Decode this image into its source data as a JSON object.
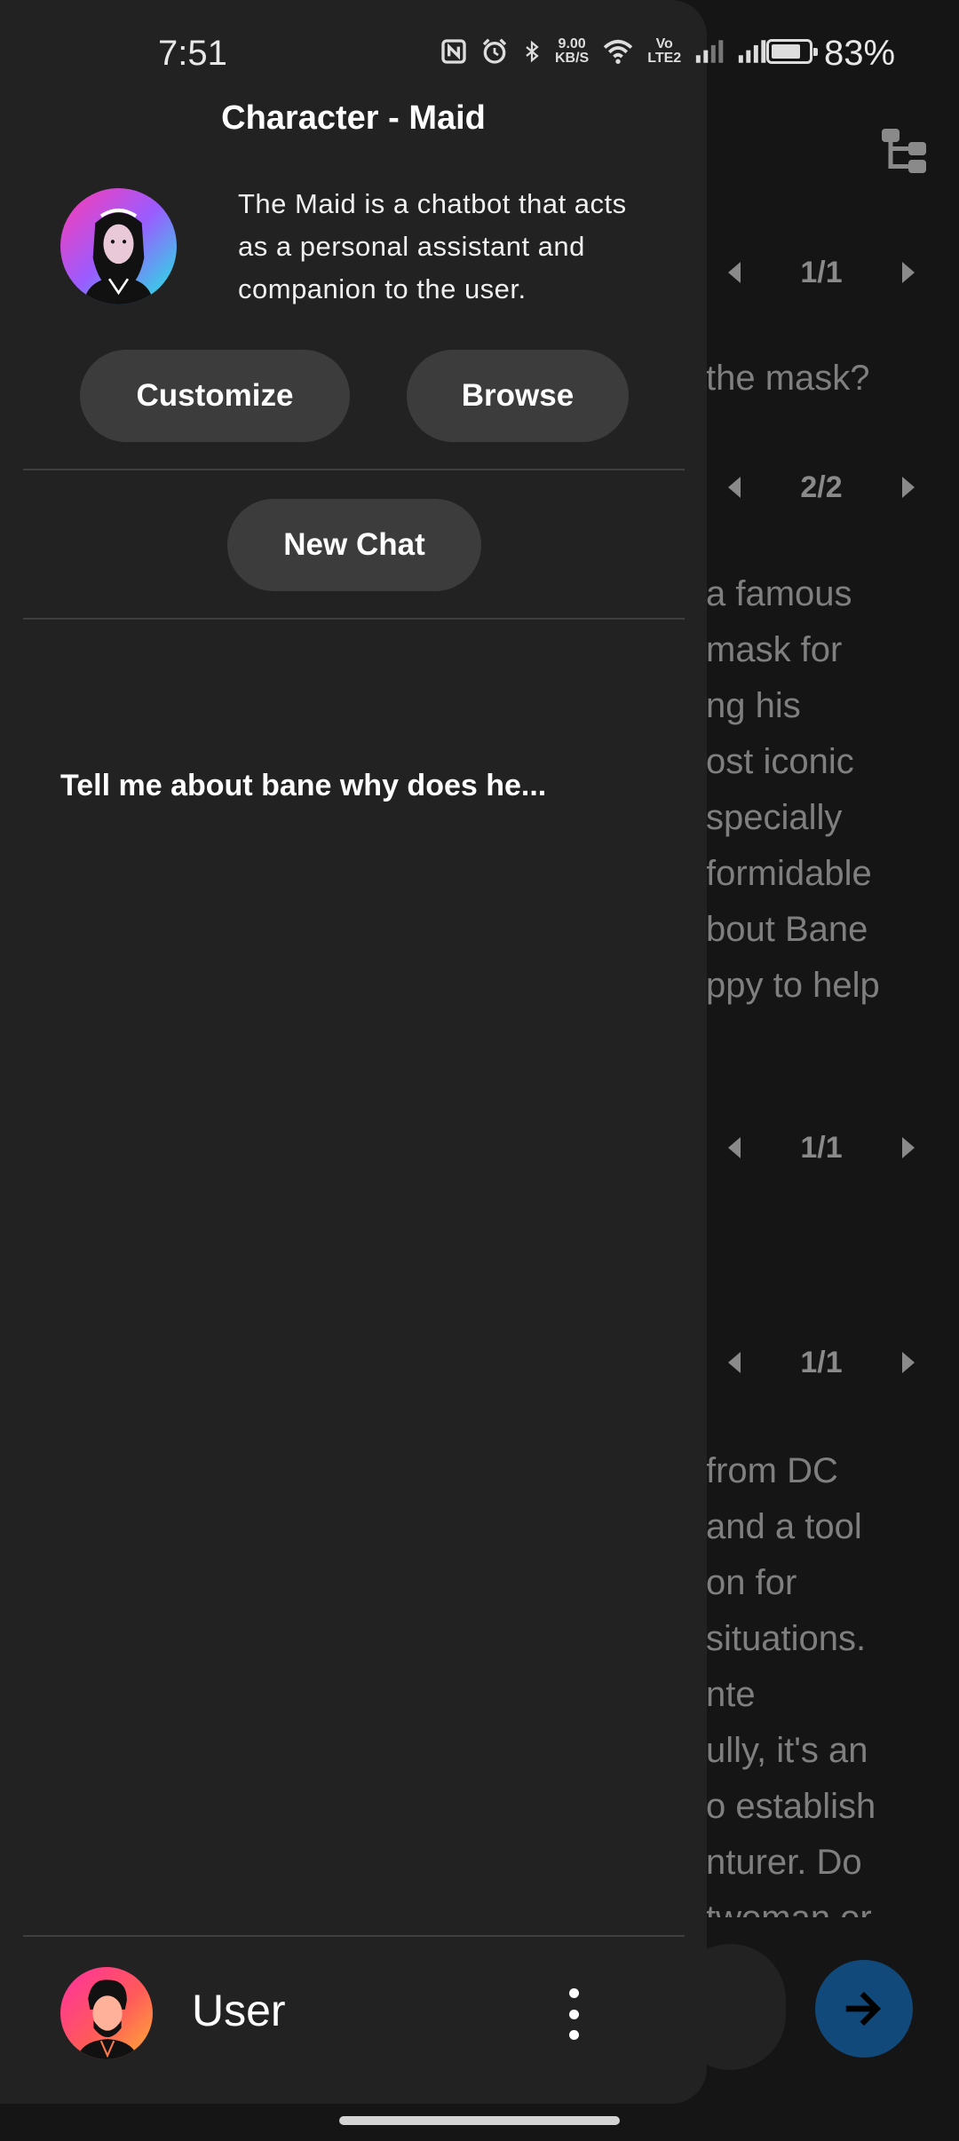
{
  "status_bar": {
    "time": "7:51",
    "net_speed_value": "9.00",
    "net_speed_unit": "KB/S",
    "volte_line1": "Vo",
    "volte_line2": "LTE2",
    "battery_percent": "83%",
    "battery_level": 0.83
  },
  "drawer": {
    "title": "Character - Maid",
    "character_description": "The Maid is a chatbot that acts as a personal assistant and companion to the user.",
    "customize_label": "Customize",
    "browse_label": "Browse",
    "new_chat_label": "New Chat",
    "chats": [
      {
        "title": "Tell me about bane why does he..."
      }
    ],
    "user": {
      "name": "User"
    }
  },
  "background_chat": {
    "pagers": [
      {
        "label": "1/1"
      },
      {
        "label": "2/2"
      },
      {
        "label": "1/1"
      },
      {
        "label": "1/1"
      }
    ],
    "question_fragment": "the mask?",
    "answer1_lines": [
      "a famous",
      "mask for",
      "ng his",
      "ost iconic",
      "specially",
      "formidable",
      "bout Bane",
      "ppy to help"
    ],
    "answer2_lines": [
      "from DC",
      "and a tool",
      "on for",
      "situations.",
      "nte",
      "ully, it's an",
      "o establish",
      "nturer. Do",
      "twoman or"
    ]
  },
  "colors": {
    "drawer_bg": "#222222",
    "page_bg": "#151515",
    "button_bg": "#3c3c3c",
    "send_button": "#114a7a"
  }
}
